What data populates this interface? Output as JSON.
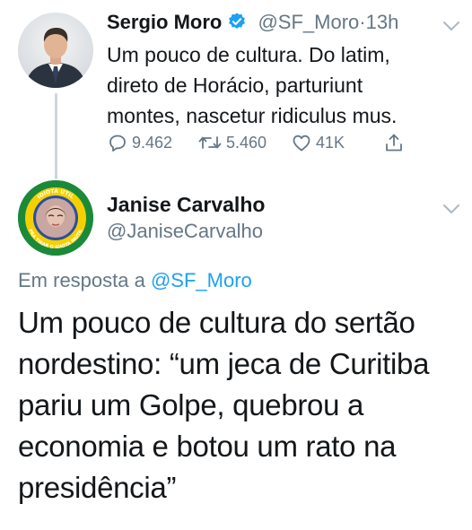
{
  "parent_tweet": {
    "author_name": "Sergio Moro",
    "handle": "@SF_Moro",
    "separator": "·",
    "time": "13h",
    "text": "Um pouco de cultura. Do latim, direto de Horácio, parturiunt montes, nascetur ridiculus mus.",
    "actions": {
      "reply_count": "9.462",
      "retweet_count": "5.460",
      "like_count": "41K"
    },
    "verified": true
  },
  "reply_tweet": {
    "author_name": "Janise Carvalho",
    "handle": "@JaniseCarvalho",
    "avatar_ring_text_top": "IDIOTA ÚTIL",
    "avatar_ring_text_bottom": "PRA TIRAR O IDIOTA INÚTIL",
    "reply_prefix": "Em resposta a",
    "reply_mention": "@SF_Moro",
    "text": "Um pouco de cultura do sertão nordestino: “um jeca de Curitiba pariu um Golpe, quebrou a economia e botou um rato na presidência”"
  },
  "colors": {
    "text": "#14171a",
    "secondary": "#657786",
    "link": "#1da1f2",
    "verified": "#1da1f2",
    "thread_line": "#ccd6dd"
  },
  "icons": [
    "reply-icon",
    "retweet-icon",
    "like-icon",
    "share-icon",
    "verified-badge-icon",
    "chevron-down-icon"
  ]
}
